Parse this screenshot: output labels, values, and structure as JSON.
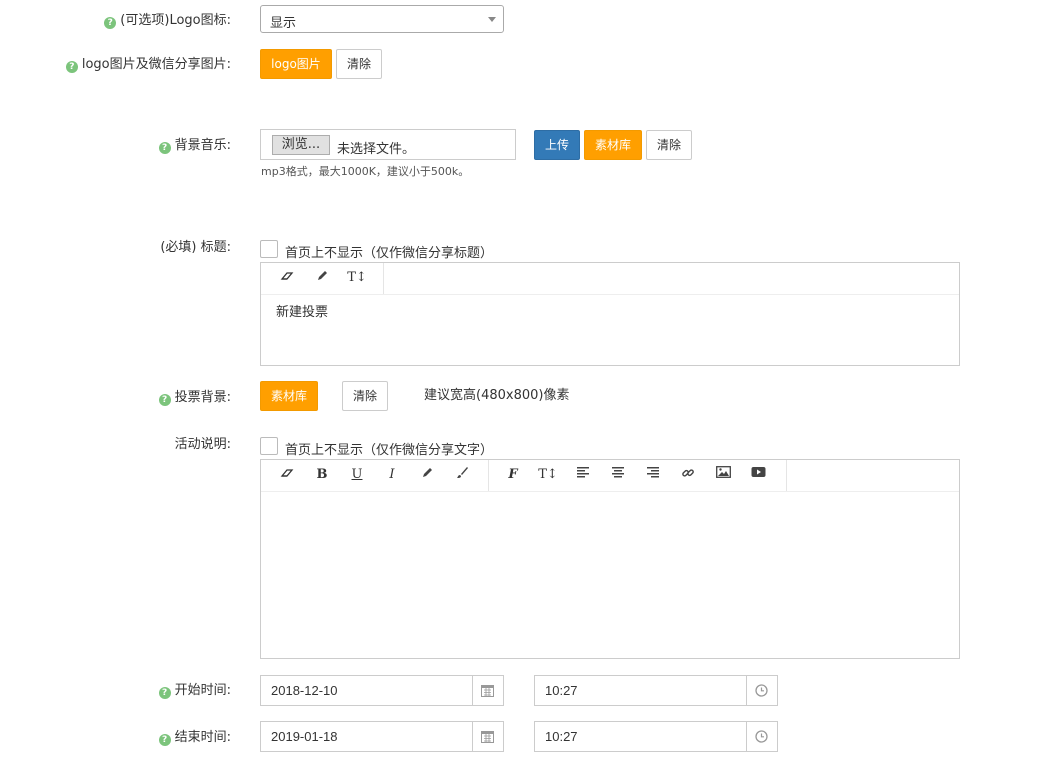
{
  "logo_icon": {
    "label": "(可选项)Logo图标:",
    "select_value": "显示"
  },
  "logo_image": {
    "label": "logo图片及微信分享图片:",
    "primary_button": "logo图片",
    "clear_button": "清除"
  },
  "music": {
    "label": "背景音乐:",
    "browse_button": "浏览...",
    "file_status": "未选择文件。",
    "upload_button": "上传",
    "library_button": "素材库",
    "clear_button": "清除",
    "hint": "mp3格式，最大1000K，建议小于500k。"
  },
  "title": {
    "label": "(必填) 标题:",
    "checkbox_label": "首页上不显示（仅作微信分享标题）",
    "content": "新建投票",
    "toolbar": [
      "eraser-icon",
      "pencil-icon",
      "text-height-icon"
    ]
  },
  "vote_bg": {
    "label": "投票背景:",
    "library_button": "素材库",
    "clear_button": "清除",
    "hint": "建议宽高(480x800)像素"
  },
  "description": {
    "label": "活动说明:",
    "checkbox_label": "首页上不显示（仅作微信分享文字）",
    "content": "",
    "toolbar": [
      "eraser-icon",
      "bold-icon",
      "underline-icon",
      "italic-icon",
      "pencil-icon",
      "brush-icon",
      "font-icon",
      "text-height-icon",
      "align-left-icon",
      "align-center-icon",
      "align-right-icon",
      "link-icon",
      "picture-icon",
      "video-icon"
    ]
  },
  "start": {
    "label": "开始时间:",
    "date": "2018-12-10",
    "time": "10:27"
  },
  "end": {
    "label": "结束时间:",
    "date": "2019-01-18",
    "time": "10:27"
  },
  "colors": {
    "orange": "#ff9f00",
    "blue": "#337ab7",
    "help_green": "#7cc47c"
  }
}
